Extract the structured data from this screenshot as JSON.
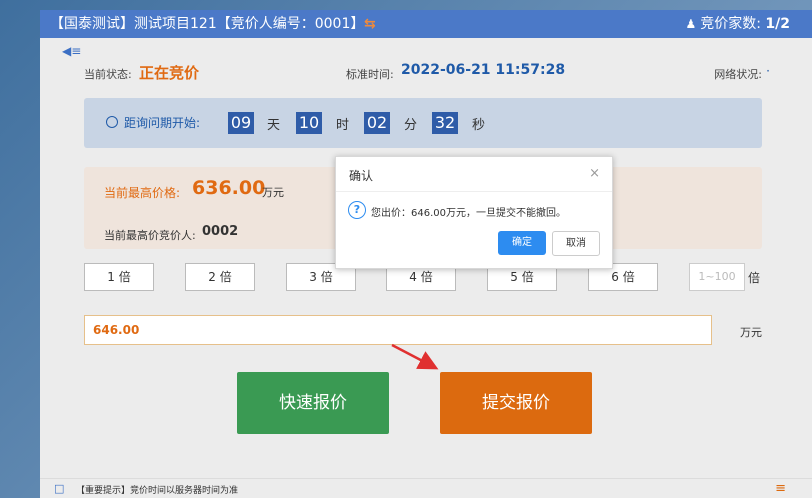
{
  "header": {
    "title": "【国泰测试】测试项目121【竞价人编号：0001】",
    "swap_icon": "⇆",
    "bid_count_label": "竞价家数:",
    "bid_count_value": "1/2"
  },
  "status": {
    "current_state_label": "当前状态:",
    "current_state_value": "正在竞价",
    "standard_time_label": "标准时间:",
    "standard_time_value": "2022-06-21 11:57:28",
    "network_label": "网络状况:",
    "network_value": "·"
  },
  "countdown": {
    "label": "距询问期开始:",
    "days": "09",
    "days_unit": "天",
    "hours": "10",
    "hours_unit": "时",
    "minutes": "02",
    "minutes_unit": "分",
    "seconds": "32",
    "seconds_unit": "秒"
  },
  "highest": {
    "price_label": "当前最高价格:",
    "price_value": "636.00",
    "price_unit": "万元",
    "bidder_label": "当前最高价竞价人:",
    "bidder_value": "0002"
  },
  "multipliers": [
    "1 倍",
    "2 倍",
    "3 倍",
    "4 倍",
    "5 倍",
    "6 倍"
  ],
  "multiplier_input_placeholder": "1~100",
  "multiplier_suffix": "倍",
  "price_input": {
    "value": "646.00",
    "unit": "万元"
  },
  "buttons": {
    "quick": "快速报价",
    "submit": "提交报价"
  },
  "footer": {
    "text": "【重要提示】竞价时间以服务器时间为准"
  },
  "dialog": {
    "title": "确认",
    "message": "您出价：646.00万元，一旦提交不能撤回。",
    "ok": "确定",
    "cancel": "取消"
  },
  "colors": {
    "accent": "#dc6a0f",
    "primary": "#2d8cf0",
    "header": "#4b79c8",
    "quick": "#3a9a53",
    "arrow": "#e03030"
  }
}
